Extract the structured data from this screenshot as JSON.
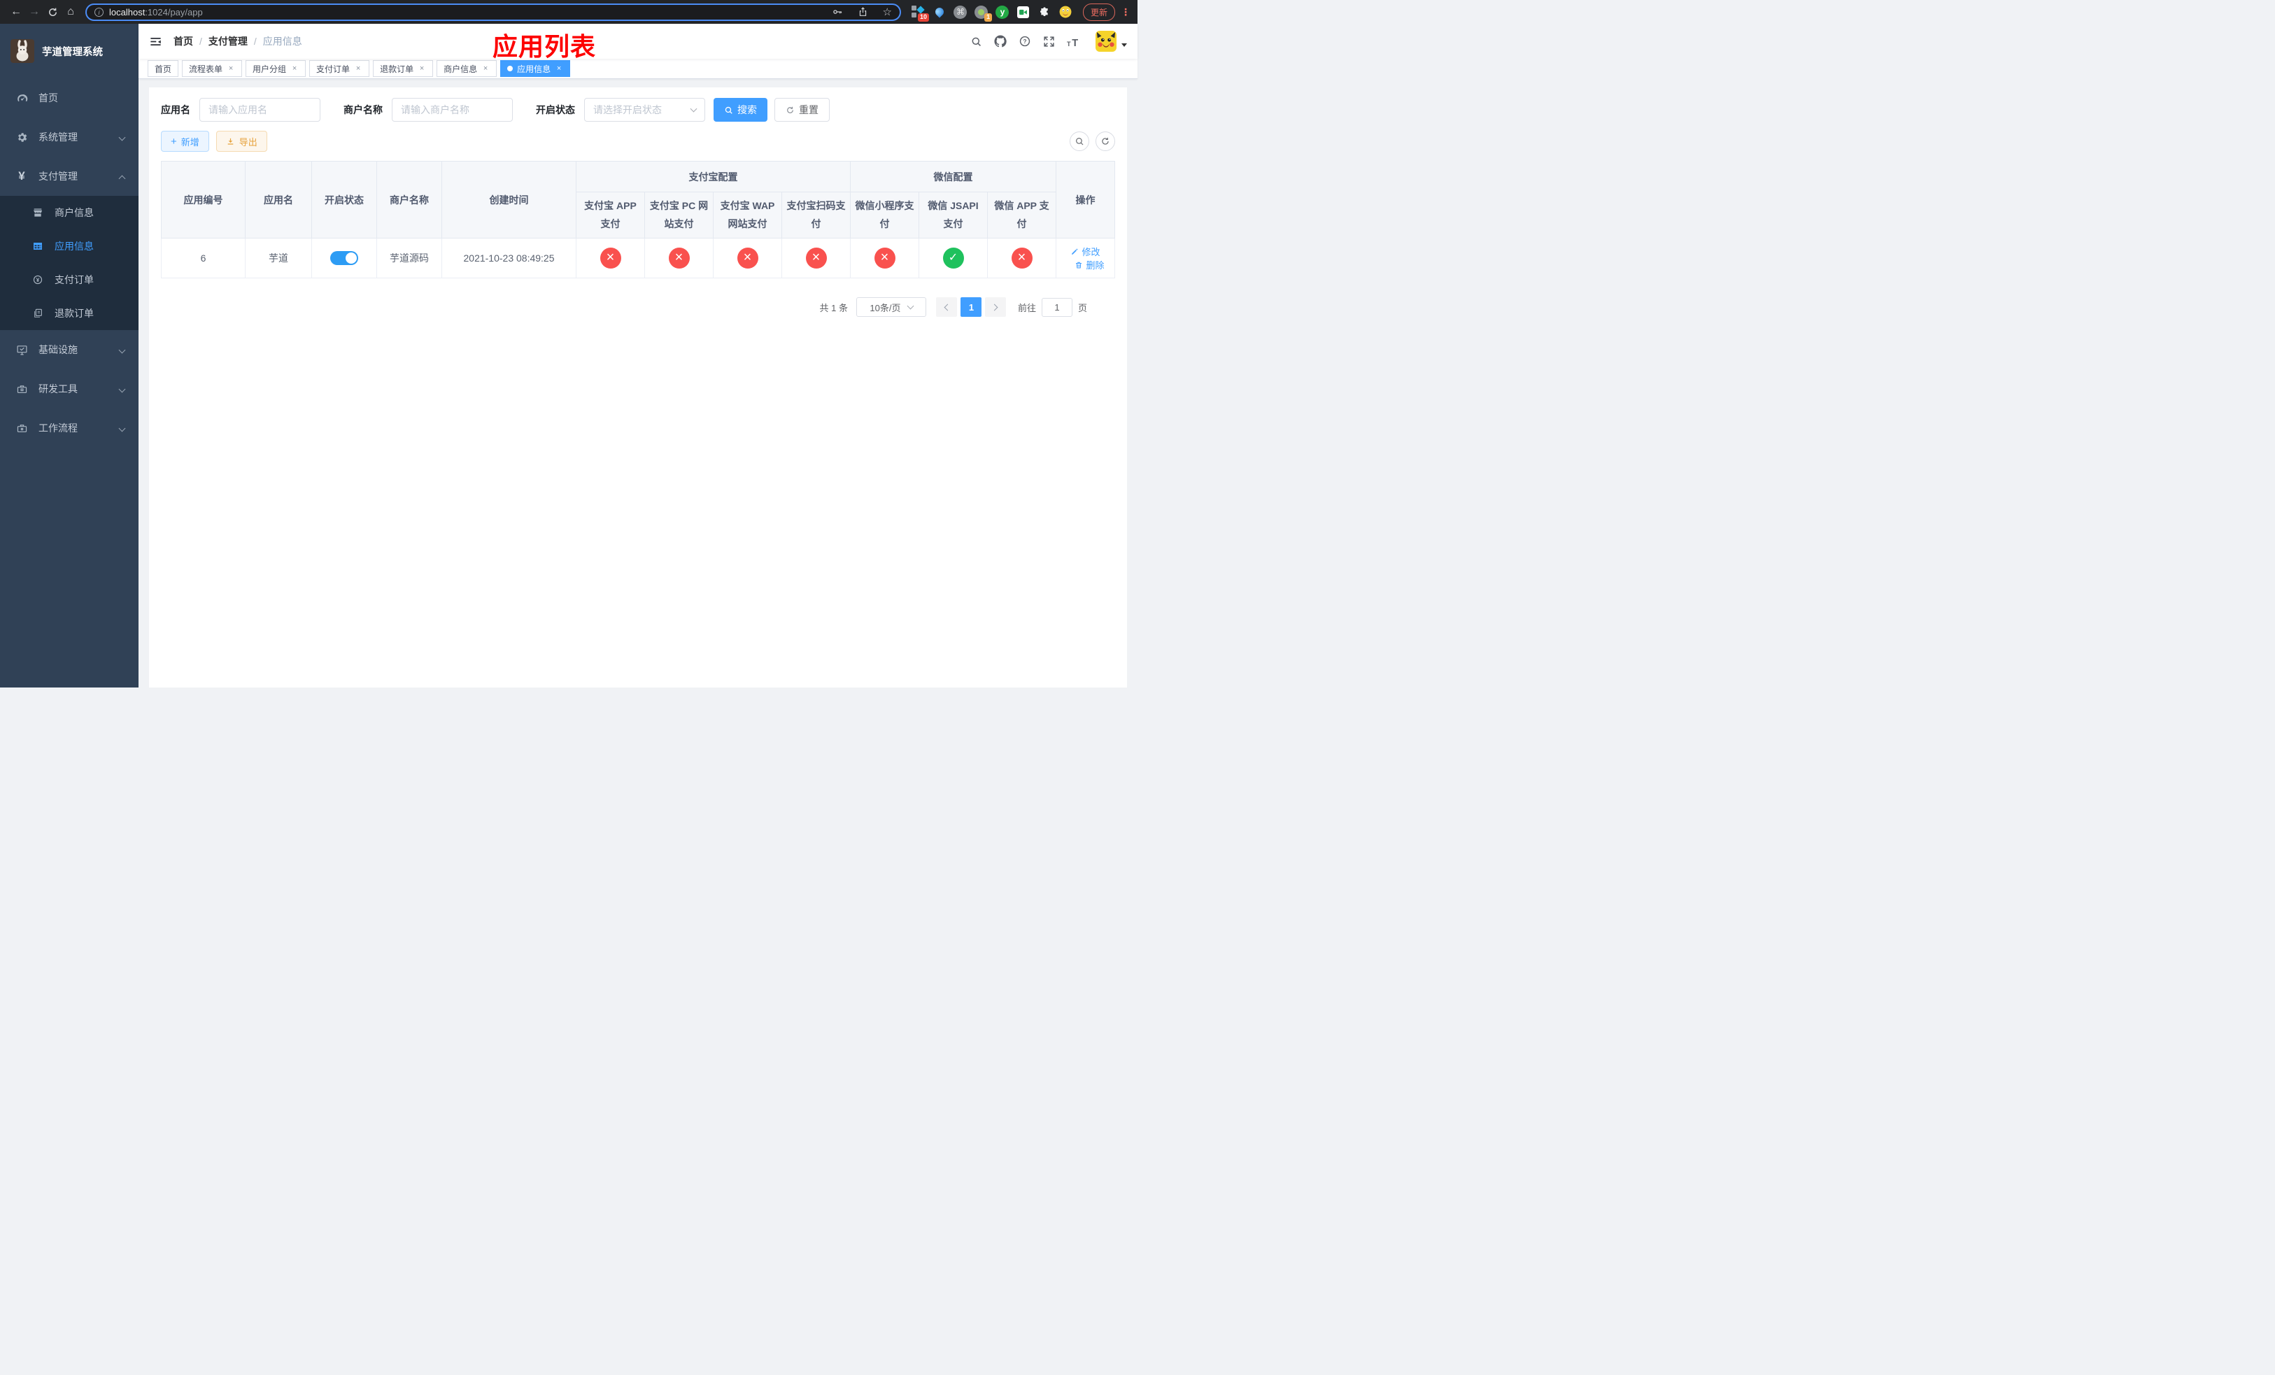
{
  "browser": {
    "url": {
      "host": "localhost",
      "rest": ":1024/pay/app"
    },
    "ext_kit_badge": "10",
    "ext_tab_badge": "1",
    "ext_y_letter": "y",
    "update_label": "更新"
  },
  "sidebar": {
    "logo_title": "芋道管理系统",
    "menu": [
      {
        "label": "首页"
      },
      {
        "label": "系统管理"
      },
      {
        "label": "支付管理"
      }
    ],
    "submenu": [
      {
        "label": "商户信息"
      },
      {
        "label": "应用信息"
      },
      {
        "label": "支付订单"
      },
      {
        "label": "退款订单"
      }
    ],
    "menu_lower": [
      {
        "label": "基础设施"
      },
      {
        "label": "研发工具"
      },
      {
        "label": "工作流程"
      }
    ]
  },
  "navbar": {
    "separator": "/",
    "breadcrumb": [
      {
        "label": "首页"
      },
      {
        "label": "支付管理"
      },
      {
        "label": "应用信息"
      }
    ],
    "overlay_title": "应用列表"
  },
  "tabs": [
    {
      "label": "首页"
    },
    {
      "label": "流程表单"
    },
    {
      "label": "用户分组"
    },
    {
      "label": "支付订单"
    },
    {
      "label": "退款订单"
    },
    {
      "label": "商户信息"
    },
    {
      "label": "应用信息"
    }
  ],
  "filters": {
    "app_name": {
      "label": "应用名",
      "placeholder": "请输入应用名",
      "value": ""
    },
    "merchant_name": {
      "label": "商户名称",
      "placeholder": "请输入商户名称",
      "value": ""
    },
    "status": {
      "label": "开启状态",
      "placeholder": "请选择开启状态"
    },
    "search_label": "搜索",
    "reset_label": "重置"
  },
  "toolbar": {
    "add_label": "新增",
    "export_label": "导出"
  },
  "table": {
    "columns": {
      "id": "应用编号",
      "name": "应用名",
      "status": "开启状态",
      "merchant": "商户名称",
      "created": "创建时间",
      "actions": "操作"
    },
    "groups": {
      "alipay": "支付宝配置",
      "wechat": "微信配置"
    },
    "pay_columns": [
      "支付宝 APP 支付",
      "支付宝 PC 网站支付",
      "支付宝 WAP 网站支付",
      "支付宝扫码支付",
      "微信小程序支付",
      "微信 JSAPI 支付",
      "微信 APP 支付"
    ],
    "row": {
      "id": "6",
      "name": "芋道",
      "merchant": "芋道源码",
      "created": "2021-10-23 08:49:25",
      "pay_status": [
        {
          "state": "fail"
        },
        {
          "state": "fail"
        },
        {
          "state": "fail"
        },
        {
          "state": "fail"
        },
        {
          "state": "fail"
        },
        {
          "state": "ok"
        },
        {
          "state": "fail"
        }
      ],
      "edit_label": "修改",
      "delete_label": "删除"
    }
  },
  "pagination": {
    "total": "共 1 条",
    "page_size": "10条/页",
    "current_page": "1",
    "goto_label": "前往",
    "goto_value": "1",
    "page_unit": "页"
  },
  "colors": {
    "primary": "#409EFF",
    "danger": "#f9514e",
    "success": "#1fc15d",
    "sidebar": "#304156"
  }
}
